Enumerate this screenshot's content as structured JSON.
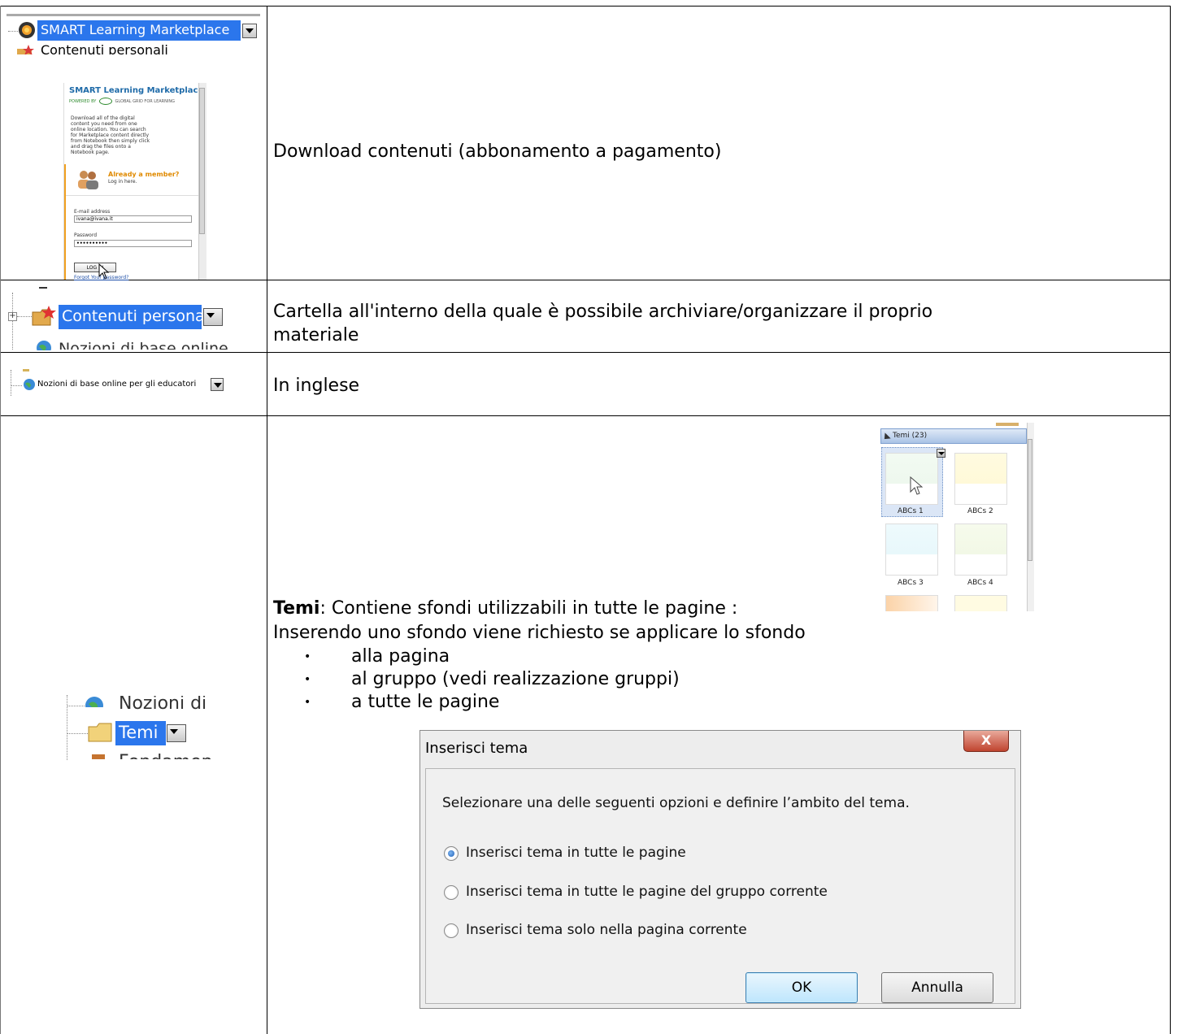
{
  "row1": {
    "tree_label": "SMART Learning Marketplace",
    "tree_next": "Contenuti personali",
    "marketplace": {
      "title": "SMART Learning Marketplace",
      "powered": "POWERED BY",
      "powered_by": "GLOBAL GRID FOR LEARNING",
      "description": "Download all of the digital\ncontent you need from one\nonline location. You can search\nfor Marketplace content directly\nfrom Notebook then simply click\nand drag the files onto a\nNotebook page.",
      "member_heading": "Already a member?",
      "member_sub": "Log in here.",
      "email_label": "E-mail address",
      "email_value": "ivana@ivana.it",
      "password_label": "Password",
      "password_value": "••••••••••",
      "login_button": "LOG IN",
      "forgot": "Forgot Your password?"
    },
    "description": "Download contenuti (abbonamento a pagamento)"
  },
  "row2": {
    "tree_label": "Contenuti personali",
    "tree_next": "Nozioni di base online",
    "description_line1": "Cartella all'interno della quale è possibile archiviare/organizzare il proprio",
    "description_line2": "materiale"
  },
  "row3": {
    "tree_label": "Nozioni di base online per gli educatori",
    "description": "In inglese"
  },
  "row4": {
    "tree_prev": "Nozioni di",
    "tree_label": "Temi",
    "tree_next": "Fondamen",
    "title_bold": "Temi",
    "title_rest": ": Contiene sfondi utilizzabili in tutte le pagine :",
    "intro": "Inserendo uno sfondo viene richiesto se applicare lo sfondo",
    "bullets": [
      "alla pagina",
      "al gruppo (vedi realizzazione gruppi)",
      "a tutte le pagine"
    ],
    "gallery": {
      "header": "Temi (23)",
      "items": [
        "ABCs 1",
        "ABCs 2",
        "ABCs 3",
        "ABCs 4"
      ]
    },
    "dialog": {
      "title": "Inserisci tema",
      "close": "X",
      "prompt": "Selezionare una delle seguenti opzioni e definire l’ambito del tema.",
      "options": [
        "Inserisci tema in tutte le pagine",
        "Inserisci tema in tutte le pagine del gruppo corrente",
        "Inserisci tema solo nella pagina corrente"
      ],
      "selected_option": "Inserisci tema in tutte le pagine",
      "ok": "OK",
      "cancel": "Annulla"
    }
  },
  "colors": {
    "selection": "#2b76ec",
    "border": "#000000"
  }
}
